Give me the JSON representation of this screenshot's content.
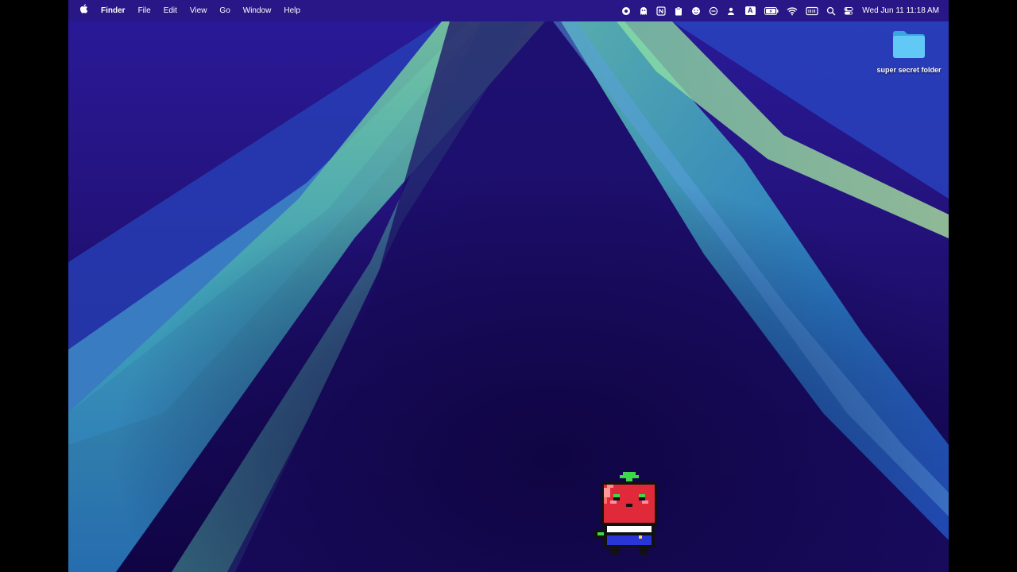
{
  "menubar": {
    "apple_icon": "apple-icon",
    "app_name": "Finder",
    "items": [
      "File",
      "Edit",
      "View",
      "Go",
      "Window",
      "Help"
    ],
    "status_icons": [
      "record-icon",
      "ghost-icon",
      "notion-icon",
      "clipboard-icon",
      "emoji-icon",
      "circle-dash-icon",
      "person-icon",
      "keyboard-input-icon",
      "battery-icon",
      "wifi-icon",
      "display-icon",
      "search-icon",
      "control-center-icon"
    ],
    "input_source": "A",
    "clock": "Wed Jun 11  11:18 AM"
  },
  "desktop": {
    "folder_label": "super secret folder",
    "folder_color": "#5ec8f5"
  },
  "wallpaper": {
    "base_color": "#24137e",
    "highlight_color": "#7fd0a0",
    "mid_color": "#2f8ec8"
  },
  "mascot": {
    "description_icon": "tomato-mascot-icon",
    "body_color": "#e02a3a",
    "leaf_color": "#3ed94a"
  }
}
